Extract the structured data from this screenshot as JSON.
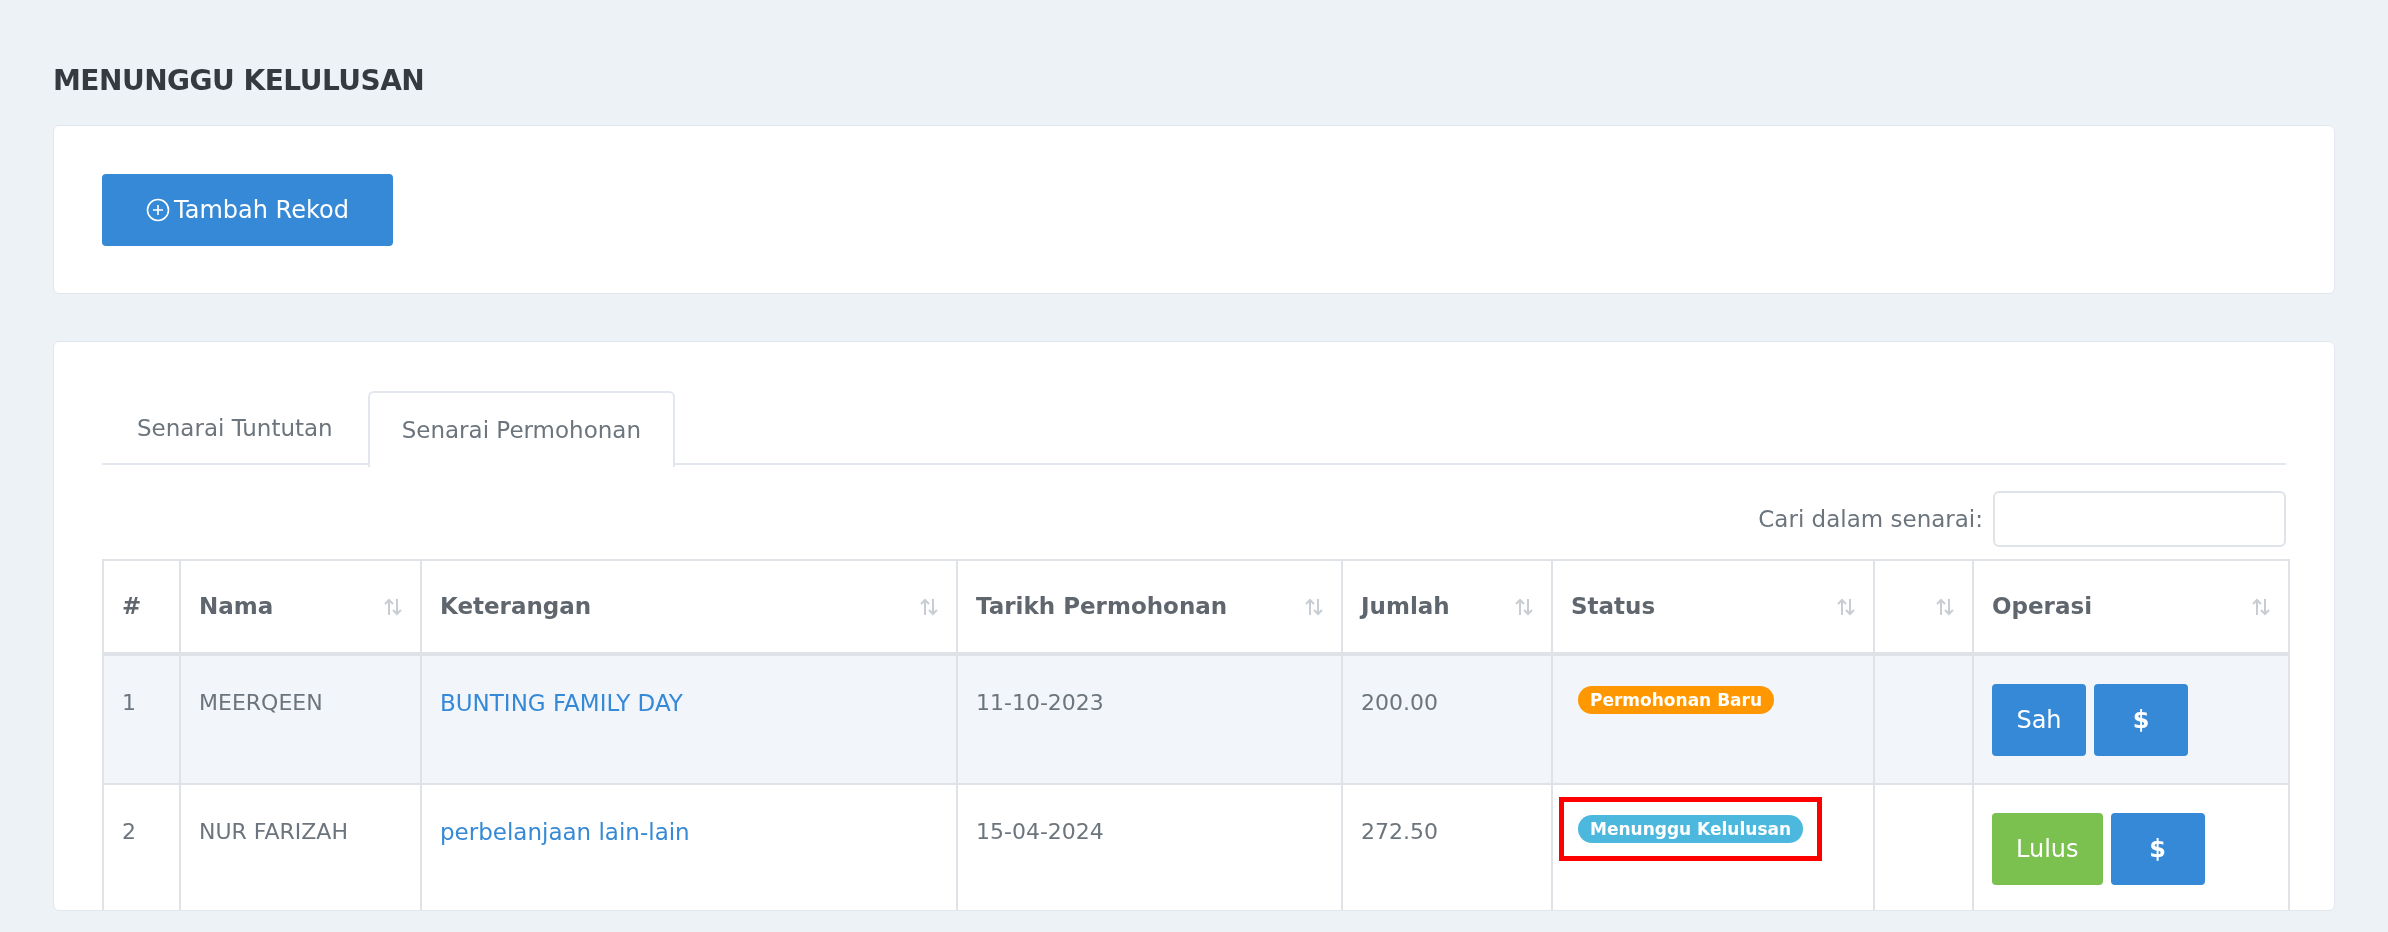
{
  "page_title": "MENUNGGU KELULUSAN",
  "add_button": {
    "label": "Tambah Rekod"
  },
  "tabs": [
    {
      "label": "Senarai Tuntutan",
      "selected": false
    },
    {
      "label": "Senarai Permohonan",
      "selected": true
    }
  ],
  "search": {
    "label": "Cari dalam senarai:"
  },
  "table": {
    "columns": [
      {
        "label": "#",
        "sortable": false
      },
      {
        "label": "Nama",
        "sortable": true
      },
      {
        "label": "Keterangan",
        "sortable": true
      },
      {
        "label": "Tarikh Permohonan",
        "sortable": true
      },
      {
        "label": "Jumlah",
        "sortable": true
      },
      {
        "label": "Status",
        "sortable": true
      },
      {
        "sortable": true
      },
      {
        "label": "Operasi",
        "sortable": true
      }
    ],
    "rows": [
      {
        "no": "1",
        "nama": "MEERQEEN",
        "keterangan": "BUNTING FAMILY DAY",
        "tarikh": "11-10-2023",
        "jumlah": "200.00",
        "status": {
          "label": "Permohonan Baru",
          "color": "#ff9800",
          "highlighted": false
        },
        "actions": [
          {
            "label": "Sah",
            "kind": "primary"
          },
          {
            "label": "$",
            "kind": "primary"
          }
        ]
      },
      {
        "no": "2",
        "nama": "NUR FARIZAH",
        "keterangan": "perbelanjaan lain-lain",
        "tarikh": "15-04-2024",
        "jumlah": "272.50",
        "status": {
          "label": "Menunggu Kelulusan",
          "color": "#4cb8de",
          "highlighted": true
        },
        "actions": [
          {
            "label": "Lulus",
            "kind": "success"
          },
          {
            "label": "$",
            "kind": "primary"
          }
        ]
      }
    ]
  }
}
